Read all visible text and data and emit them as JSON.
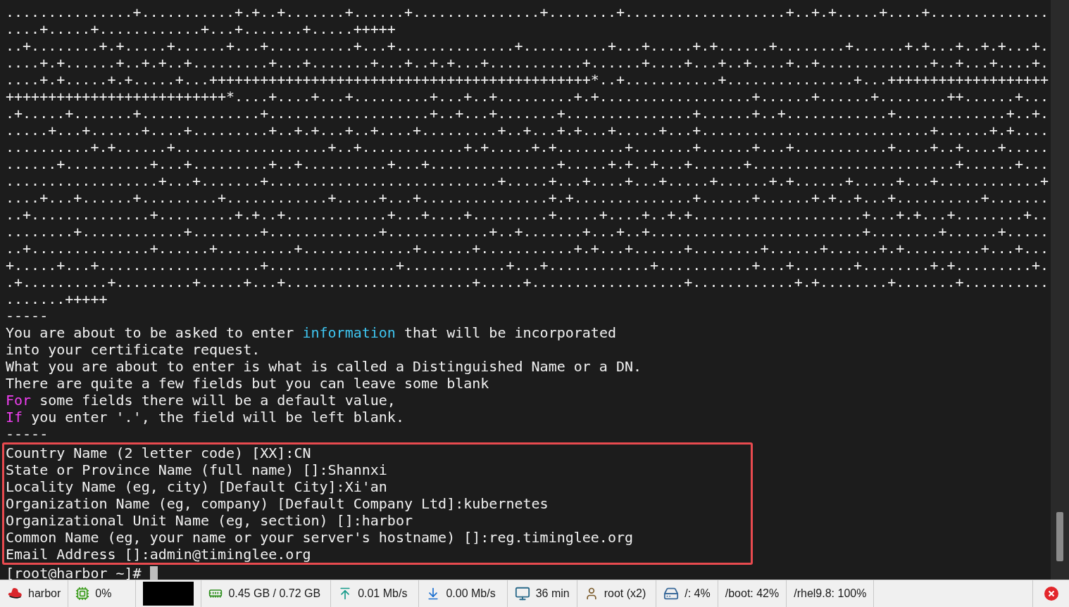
{
  "terminal": {
    "random_art": [
      "...............+...........+.+..+.......+......+...............+........+...................+..+.+.....+....+..............",
      "....+.....+............+...+.......+.....+++++",
      "..+........+.+.....+......+...+..........+...+..............+..........+...+.....+.+......+........+......+.+...+..+.+...+.",
      "....+.+......+..+.+..+.........+...+.......+...+..+.+...+...........+......+....+...+..+....+..+.............+..+...+....+.",
      "....+.+.....+.+.....+...+++++++++++++++++++++++++++++++++++++++++++++*..+...........+...............+...+++++++++++++++++++",
      "++++++++++++++++++++++++++*....+....+...+.........+...+..+.........+.+..................+......+......+........++......+...",
      ".+.....+.......+..............+...................+..+...+.......+...............+......+..+............+.............+..+.",
      ".....+...+......+....+.........+..+.+...+..+....+.........+..+...+.+...+.....+...+...........................+......+.+....",
      "..........+.+......+..................+..+............+.+.....+.+........+.......+......+...+...........+....+..+....+.....",
      "......+..........+...+.........+..+..........+...+...............+.....+.+..+...+......+........................+......+...",
      "..................+...+.......+...........................+.....+...+....+...+.....+......+.+......+.....+...+............+",
      "....+...+......+.........+............+.....+...+...............+.+..............+......+......+.+..+...+..........+.......",
      "..+..............+.........+.+..+............+...+....+.........+.....+....+..+.+....................+...+.+...+........+..",
      "........+............+........+.............+............+..+.......+...+..+.........................+........+......+.....",
      "..+..............+......+.........+.............+......+...........+.+...+......+........+......+......+.+.........+...+...",
      "+.....+...+...................+...............+............+...+............+...........+...+.......+........+.+.........+.",
      ".+..........+.........+.....+...+......................+.....+..................+............+.+........+.......+..........",
      ".......+++++"
    ],
    "separator_top": "-----",
    "notice_lines": [
      [
        {
          "text": "You are about to be asked to enter ",
          "color": "#f0f0f0"
        },
        {
          "text": "information",
          "color": "#3fc5f0"
        },
        {
          "text": " that will be incorporated",
          "color": "#f0f0f0"
        }
      ],
      [
        {
          "text": "into your certificate request.",
          "color": "#f0f0f0"
        }
      ],
      [
        {
          "text": "What you are about to enter is what is called a Distinguished Name or a DN.",
          "color": "#f0f0f0"
        }
      ],
      [
        {
          "text": "There are quite a few fields but you can leave some blank",
          "color": "#f0f0f0"
        }
      ],
      [
        {
          "text": "For",
          "color": "#ef3ff0"
        },
        {
          "text": " some fields there will be a default value,",
          "color": "#f0f0f0"
        }
      ],
      [
        {
          "text": "If",
          "color": "#ef3ff0"
        },
        {
          "text": " you enter '.', the field will be left blank.",
          "color": "#f0f0f0"
        }
      ]
    ],
    "separator_bottom": "-----",
    "highlighted_fields": [
      "Country Name (2 letter code) [XX]:CN",
      "State or Province Name (full name) []:Shannxi",
      "Locality Name (eg, city) [Default City]:Xi'an",
      "Organization Name (eg, company) [Default Company Ltd]:kubernetes",
      "Organizational Unit Name (eg, section) []:harbor",
      "Common Name (eg, your name or your server's hostname) []:reg.timinglee.org",
      "Email Address []:admin@timinglee.org"
    ],
    "prompt": "[root@harbor ~]#"
  },
  "status_bar": [
    {
      "kind": "host",
      "text": "harbor"
    },
    {
      "kind": "cpu",
      "text": "0%"
    },
    {
      "kind": "graph"
    },
    {
      "kind": "memory",
      "text": "0.45 GB / 0.72 GB"
    },
    {
      "kind": "upload",
      "text": "0.01 Mb/s"
    },
    {
      "kind": "download",
      "text": "0.00 Mb/s"
    },
    {
      "kind": "uptime",
      "text": "36 min"
    },
    {
      "kind": "user",
      "text": "root (x2)"
    },
    {
      "kind": "disk",
      "text": "/: 4%"
    },
    {
      "kind": "plain",
      "text": "/boot: 42%"
    },
    {
      "kind": "plain",
      "text": "/rhel9.8: 100%"
    },
    {
      "kind": "close"
    }
  ]
}
